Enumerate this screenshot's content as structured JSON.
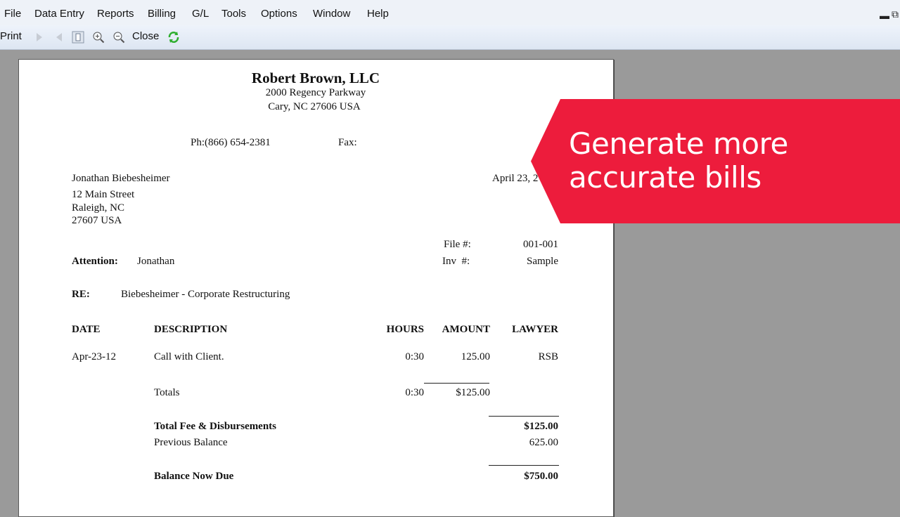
{
  "menu": [
    "File",
    "Data Entry",
    "Reports",
    "Billing",
    "G/L",
    "Tools",
    "Options",
    "Window",
    "Help"
  ],
  "toolbar": {
    "print_label": "Print",
    "close_label": "Close"
  },
  "invoice": {
    "firm_name": "Robert Brown, LLC",
    "address_line1": "2000 Regency Parkway",
    "address_line2": "Cary, NC 27606 USA",
    "phone": "Ph:(866) 654-2381",
    "fax": "Fax:",
    "client_name": "Jonathan Biebesheimer",
    "client_street": "12 Main Street",
    "client_city": "Raleigh, NC",
    "client_zip": "27607 USA",
    "date": "April 23, 2",
    "file_label": "File #:",
    "file_value": "001-001",
    "inv_label": "Inv  #:",
    "inv_value": "Sample",
    "attention_label": "Attention:",
    "attention_value": "Jonathan",
    "re_label": "RE:",
    "re_value": "Biebesheimer - Corporate Restructuring",
    "columns": {
      "date": "DATE",
      "description": "DESCRIPTION",
      "hours": "HOURS",
      "amount": "AMOUNT",
      "lawyer": "LAWYER"
    },
    "entry": {
      "date": "Apr-23-12",
      "description": "Call with Client.",
      "hours": "0:30",
      "amount": "125.00",
      "lawyer": "RSB"
    },
    "totals": {
      "label": "Totals",
      "hours": "0:30",
      "amount": "$125.00"
    },
    "total_fee_label": "Total Fee & Disbursements",
    "total_fee_value": "$125.00",
    "previous_balance_label": "Previous Balance",
    "previous_balance_value": "625.00",
    "balance_due_label": "Balance Now Due",
    "balance_due_value": "$750.00"
  },
  "banner": {
    "line1": "Generate more",
    "line2": "accurate bills",
    "color": "#ed1c3c"
  }
}
